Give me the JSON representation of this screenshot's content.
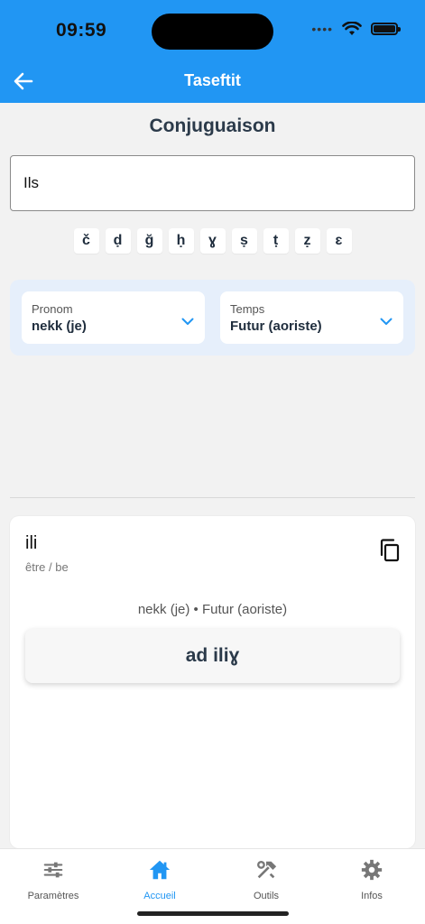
{
  "status_bar": {
    "time": "09:59",
    "signal_dots": "••••"
  },
  "app_bar": {
    "title": "Taseftit",
    "back_icon": "back-arrow-icon"
  },
  "page": {
    "title": "Conjuguaison"
  },
  "verb_input": {
    "value": "Ils",
    "placeholder": ""
  },
  "special_chars": [
    "č",
    "ḍ",
    "ğ",
    "ḥ",
    "ɣ",
    "ṣ",
    "ṭ",
    "ẓ",
    "ɛ"
  ],
  "selectors": {
    "pronoun": {
      "label": "Pronom",
      "value": "nekk (je)"
    },
    "tense": {
      "label": "Temps",
      "value": "Futur (aoriste)"
    }
  },
  "result": {
    "verb": "ili",
    "translation": "être / be",
    "context": "nekk (je) • Futur (aoriste)",
    "conjugation": "ad iliɣ",
    "copy_icon": "copy-icon"
  },
  "bottom_nav": [
    {
      "label": "Paramètres",
      "icon": "sliders-icon",
      "active": false
    },
    {
      "label": "Accueil",
      "icon": "home-icon",
      "active": true
    },
    {
      "label": "Outils",
      "icon": "tools-icon",
      "active": false
    },
    {
      "label": "Infos",
      "icon": "gear-icon",
      "active": false
    }
  ],
  "colors": {
    "primary": "#2196f3",
    "background": "#f2f2f2",
    "panel": "#e6effb",
    "text": "#1f2d3d"
  }
}
